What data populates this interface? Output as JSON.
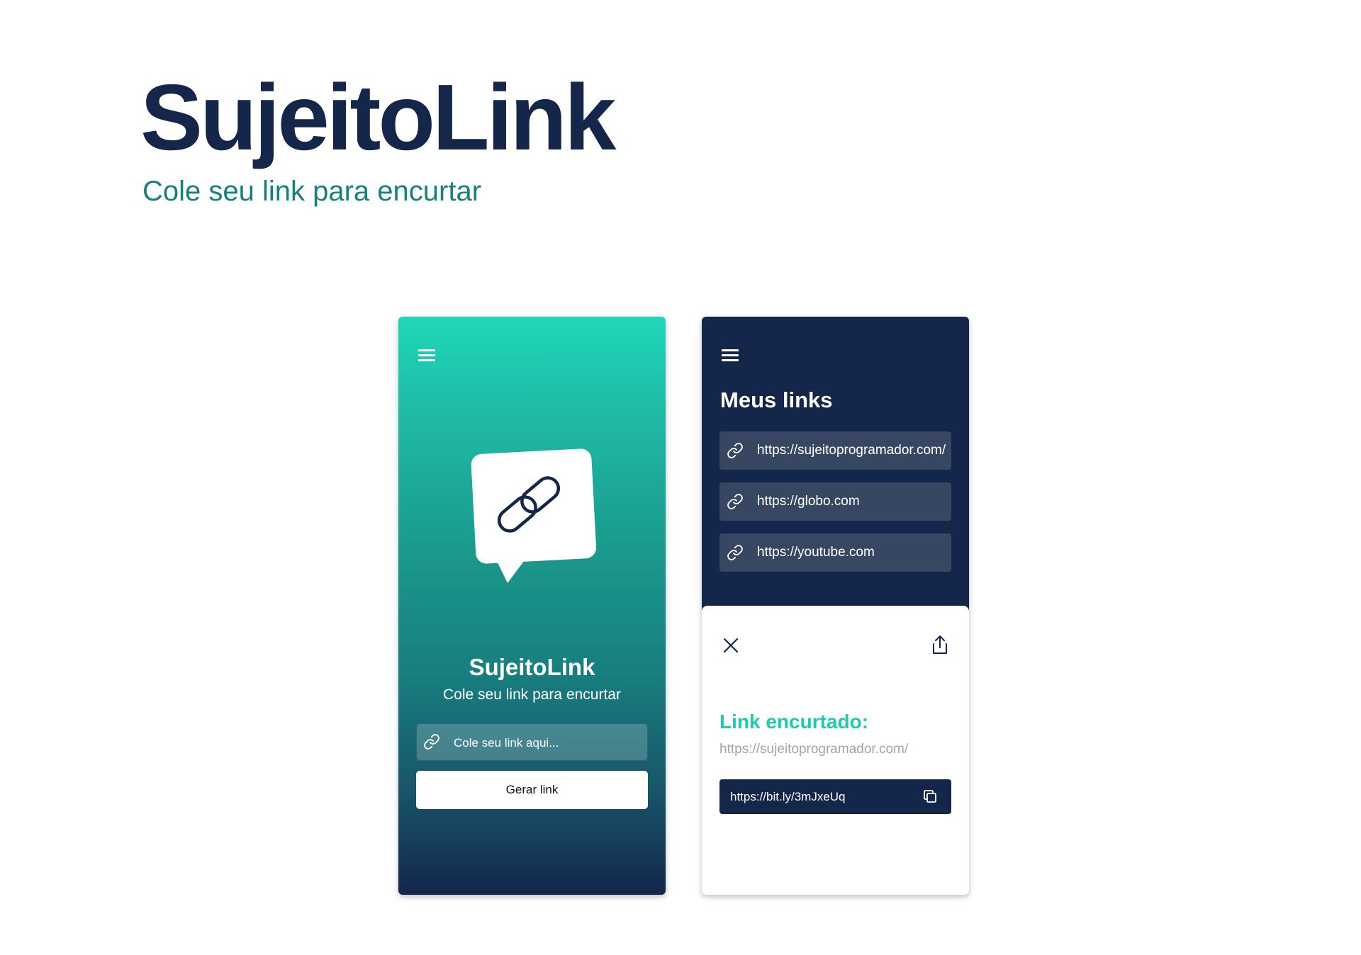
{
  "hero": {
    "title": "SujeitoLink",
    "subtitle": "Cole seu link para encurtar"
  },
  "home_screen": {
    "menu_icon": "menu-icon",
    "logo_icon": "chat-bubble-link-logo",
    "title": "SujeitoLink",
    "subtitle": "Cole seu link para encurtar",
    "input": {
      "icon": "link-icon",
      "placeholder": "Cole seu link aqui...",
      "value": ""
    },
    "button_label": "Gerar link"
  },
  "links_screen": {
    "menu_icon": "menu-icon",
    "title": "Meus links",
    "items": [
      {
        "icon": "link-icon",
        "url": "https://sujeitoprogramador.com/"
      },
      {
        "icon": "link-icon",
        "url": "https://globo.com"
      },
      {
        "icon": "link-icon",
        "url": "https://youtube.com"
      }
    ],
    "modal": {
      "close_icon": "close-icon",
      "share_icon": "share-icon",
      "label": "Link encurtado:",
      "original_url": "https://sujeitoprogramador.com/",
      "short_url": "https://bit.ly/3mJxeUq",
      "copy_icon": "copy-icon"
    }
  },
  "colors": {
    "navy": "#14264a",
    "teal": "#1fd8b8",
    "accent_teal": "#1fcaaf",
    "subtitle_teal": "#18807a",
    "link_item_bg": "#374761"
  }
}
